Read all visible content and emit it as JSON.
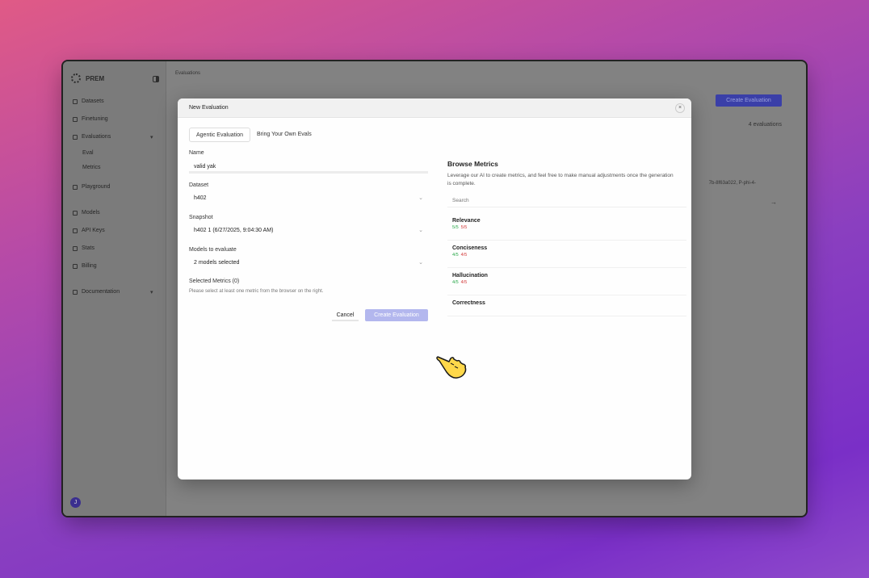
{
  "app": {
    "brand": "PREM"
  },
  "sidebar": {
    "items": [
      {
        "label": "Datasets"
      },
      {
        "label": "Finetuning"
      },
      {
        "label": "Evaluations"
      },
      {
        "label": "Playground"
      },
      {
        "label": "Models"
      },
      {
        "label": "API Keys"
      },
      {
        "label": "Stats"
      },
      {
        "label": "Billing"
      },
      {
        "label": "Documentation"
      }
    ],
    "subitems": [
      {
        "label": "Eval"
      },
      {
        "label": "Metrics"
      }
    ],
    "avatar": "J"
  },
  "main": {
    "breadcrumb": "Evaluations",
    "create_button": "Create Evaluation",
    "count": "4 evaluations",
    "row_hash": "7b-8f63a022, P-phi-4-",
    "row_arrow": "→"
  },
  "modal": {
    "title": "New Evaluation",
    "close": "×",
    "tabs": [
      {
        "label": "Agentic Evaluation"
      },
      {
        "label": "Bring Your Own Evals"
      }
    ],
    "form": {
      "name_label": "Name",
      "name_value": "valid yak",
      "dataset_label": "Dataset",
      "dataset_value": "h402",
      "snapshot_label": "Snapshot",
      "snapshot_value": "h402 1 (6/27/2025, 9:04:30 AM)",
      "models_label": "Models to evaluate",
      "models_value": "2 models selected",
      "selected_metrics_label": "Selected Metrics (0)",
      "selected_metrics_hint": "Please select at least one metric from the browser on the right.",
      "cancel": "Cancel",
      "create": "Create Evaluation"
    },
    "browse": {
      "title": "Browse Metrics",
      "description": "Leverage our AI to create metrics, and feel free to make manual adjustments once the generation is complete.",
      "search_placeholder": "Search",
      "metrics": [
        {
          "name": "Relevance",
          "good": "5/5",
          "bad": "5/5"
        },
        {
          "name": "Conciseness",
          "good": "4/5",
          "bad": "4/5"
        },
        {
          "name": "Hallucination",
          "good": "4/5",
          "bad": "4/5"
        },
        {
          "name": "Correctness",
          "good": "",
          "bad": ""
        }
      ]
    }
  },
  "icons": {
    "dropdown": "chevron-down-icon",
    "pointer": "hand-pointer-icon"
  }
}
